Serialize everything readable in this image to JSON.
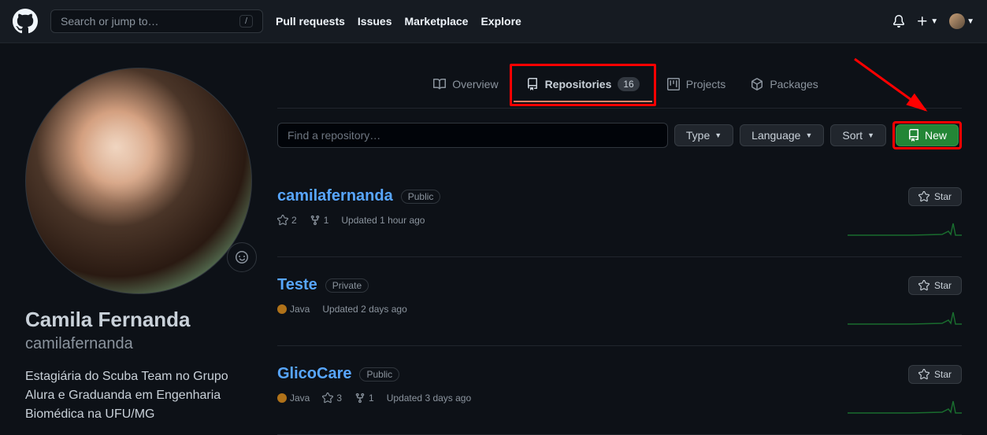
{
  "header": {
    "search_placeholder": "Search or jump to…",
    "slash": "/",
    "nav": {
      "pull_requests": "Pull requests",
      "issues": "Issues",
      "marketplace": "Marketplace",
      "explore": "Explore"
    }
  },
  "profile": {
    "name": "Camila Fernanda",
    "username": "camilafernanda",
    "bio": "Estagiária do Scuba Team no Grupo Alura e Graduanda em Engenharia Biomédica na UFU/MG"
  },
  "tabs": {
    "overview": "Overview",
    "repositories": "Repositories",
    "repo_count": "16",
    "projects": "Projects",
    "packages": "Packages"
  },
  "filters": {
    "find_placeholder": "Find a repository…",
    "type": "Type",
    "language": "Language",
    "sort": "Sort",
    "new": "New"
  },
  "actions": {
    "star": "Star"
  },
  "repos": [
    {
      "name": "camilafernanda",
      "visibility": "Public",
      "stars": "2",
      "forks": "1",
      "updated": "Updated 1 hour ago",
      "language": null
    },
    {
      "name": "Teste",
      "visibility": "Private",
      "stars": null,
      "forks": null,
      "updated": "Updated 2 days ago",
      "language": "Java",
      "lang_color": "#b07219"
    },
    {
      "name": "GlicoCare",
      "visibility": "Public",
      "stars": "3",
      "forks": "1",
      "updated": "Updated 3 days ago",
      "language": "Java",
      "lang_color": "#b07219"
    }
  ]
}
